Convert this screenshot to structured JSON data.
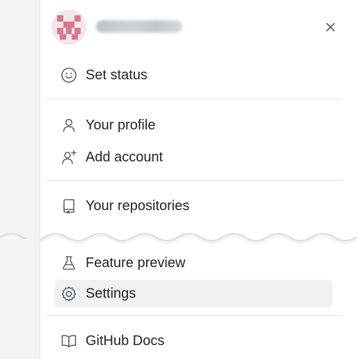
{
  "menu": {
    "set_status": "Set status",
    "your_profile": "Your profile",
    "add_account": "Add account",
    "your_repositories": "Your repositories",
    "feature_preview": "Feature preview",
    "settings": "Settings",
    "github_docs": "GitHub Docs"
  },
  "icons": {
    "avatar": "identicon-avatar",
    "close": "close-icon",
    "set_status": "smiley-icon",
    "your_profile": "person-icon",
    "add_account": "person-add-icon",
    "your_repositories": "repo-icon",
    "feature_preview": "beaker-icon",
    "settings": "gear-icon",
    "github_docs": "book-icon"
  },
  "colors": {
    "avatar_pink": "#d9788c",
    "active_background": "#eff1f3",
    "text": "#1f2328",
    "icon": "#59636e"
  }
}
